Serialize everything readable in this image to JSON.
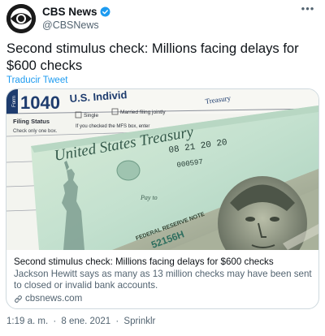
{
  "author": {
    "display_name": "CBS News",
    "handle": "@CBSNews",
    "verified": true,
    "avatar_icon": "cbs-eye-logo-icon"
  },
  "menu": {
    "more_label": "•••"
  },
  "tweet": {
    "text": "Second stimulus check: Millions facing delays for $600 checks",
    "translate_label": "Traducir Tweet"
  },
  "card": {
    "image_icon": "stimulus-check-photo",
    "title": "Second stimulus check: Millions facing delays for $600 checks",
    "description": "Jackson Hewitt says as many as 13 million checks may have been sent to closed or invalid bank accounts.",
    "domain": "cbsnews.com",
    "domain_icon": "link-icon",
    "image_text": {
      "form_number": "1040",
      "form_us": "U.S. Individ",
      "form_side": "Form",
      "filing_status": "Filing Status",
      "check_only": "Check only one box.",
      "single": "Single",
      "married": "Married filing jointly",
      "mfs": "If you checked the MFS box, enter",
      "treasury_top": "Treasury",
      "treasury_main": "United States Treasury",
      "check_date": "08 21 20 20",
      "check_code": "000597",
      "serial": "52156H",
      "reserve": "FEDERAL RESERVE NOTE",
      "pay_to": "Pay to"
    }
  },
  "meta": {
    "time": "1:19 a. m.",
    "date": "8 ene. 2021",
    "source": "Sprinklr",
    "separator": "·"
  },
  "colors": {
    "accent": "#1d9bf0",
    "text_primary": "#0f1419",
    "text_secondary": "#536471",
    "border": "#cfd9de"
  }
}
